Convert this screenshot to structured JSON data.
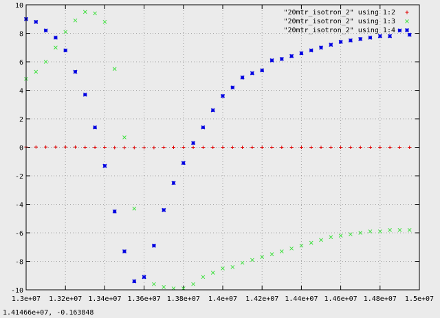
{
  "status": {
    "coords": "1.41466e+07, -0.163848"
  },
  "colors": {
    "background": "#ebebeb",
    "grid": "#a0a0a0",
    "series1": "#e00000",
    "series2": "#40e040",
    "series3": "#0000e0"
  },
  "chart_data": {
    "type": "scatter",
    "title": "",
    "xlabel": "",
    "ylabel": "",
    "xlim": [
      13000000,
      15000000
    ],
    "ylim": [
      -10,
      10
    ],
    "grid": true,
    "legend_position": "top-right",
    "x_ticks": [
      13000000,
      13200000,
      13400000,
      13600000,
      13800000,
      14000000,
      14200000,
      14400000,
      14600000,
      14800000,
      15000000
    ],
    "x_tick_labels": [
      "1.3e+07",
      "1.32e+07",
      "1.34e+07",
      "1.36e+07",
      "1.38e+07",
      "1.4e+07",
      "1.42e+07",
      "1.44e+07",
      "1.46e+07",
      "1.48e+07",
      "1.5e+07"
    ],
    "y_ticks": [
      -10,
      -8,
      -6,
      -4,
      -2,
      0,
      2,
      4,
      6,
      8,
      10
    ],
    "y_tick_labels": [
      "-10",
      "-8",
      "-6",
      "-4",
      "-2",
      "0",
      "2",
      "4",
      "6",
      "8",
      "10"
    ],
    "x": [
      13000000,
      13050000,
      13100000,
      13150000,
      13200000,
      13250000,
      13300000,
      13350000,
      13400000,
      13450000,
      13500000,
      13550000,
      13600000,
      13650000,
      13700000,
      13750000,
      13800000,
      13850000,
      13900000,
      13950000,
      14000000,
      14050000,
      14100000,
      14150000,
      14200000,
      14250000,
      14300000,
      14350000,
      14400000,
      14450000,
      14500000,
      14550000,
      14600000,
      14650000,
      14700000,
      14750000,
      14800000,
      14850000,
      14900000,
      14950000
    ],
    "series": [
      {
        "name": "\"20mtr_isotron_2\" using 1:2",
        "marker": "+",
        "color": "#e00000",
        "values": [
          0.02,
          0.02,
          0.02,
          0.02,
          0.02,
          0.02,
          0.0,
          0.0,
          0.0,
          -0.02,
          -0.02,
          -0.02,
          -0.02,
          -0.02,
          0.0,
          0.0,
          0.0,
          0.0,
          0.0,
          0.0,
          0.0,
          0.0,
          0.0,
          0.0,
          0.0,
          0.0,
          0.0,
          0.0,
          0.0,
          0.0,
          0.0,
          0.0,
          0.0,
          0.0,
          0.0,
          0.0,
          0.0,
          0.0,
          0.0,
          0.0
        ]
      },
      {
        "name": "\"20mtr_isotron_2\" using 1:3",
        "marker": "x",
        "color": "#40e040",
        "values": [
          4.8,
          5.3,
          6.0,
          7.0,
          8.1,
          8.9,
          9.5,
          9.4,
          8.8,
          5.5,
          0.7,
          -4.3,
          -9.1,
          -9.6,
          -9.8,
          -9.9,
          -9.9,
          -9.6,
          -9.1,
          -8.8,
          -8.5,
          -8.4,
          -8.1,
          -7.9,
          -7.7,
          -7.5,
          -7.3,
          -7.1,
          -6.9,
          -6.7,
          -6.5,
          -6.3,
          -6.2,
          -6.1,
          -6.0,
          -5.9,
          -5.9,
          -5.8,
          -5.8,
          -5.8
        ]
      },
      {
        "name": "\"20mtr_isotron_2\" using 1:4",
        "marker": "*",
        "color": "#0000e0",
        "values": [
          9.0,
          8.8,
          8.2,
          7.7,
          6.8,
          5.3,
          3.7,
          1.4,
          -1.3,
          -4.5,
          -7.3,
          -9.4,
          -9.1,
          -6.9,
          -4.4,
          -2.5,
          -1.1,
          0.3,
          1.4,
          2.6,
          3.6,
          4.2,
          4.9,
          5.2,
          5.4,
          6.1,
          6.2,
          6.4,
          6.6,
          6.8,
          7.0,
          7.2,
          7.4,
          7.5,
          7.6,
          7.7,
          7.8,
          7.8,
          8.2,
          7.9
        ]
      }
    ]
  }
}
